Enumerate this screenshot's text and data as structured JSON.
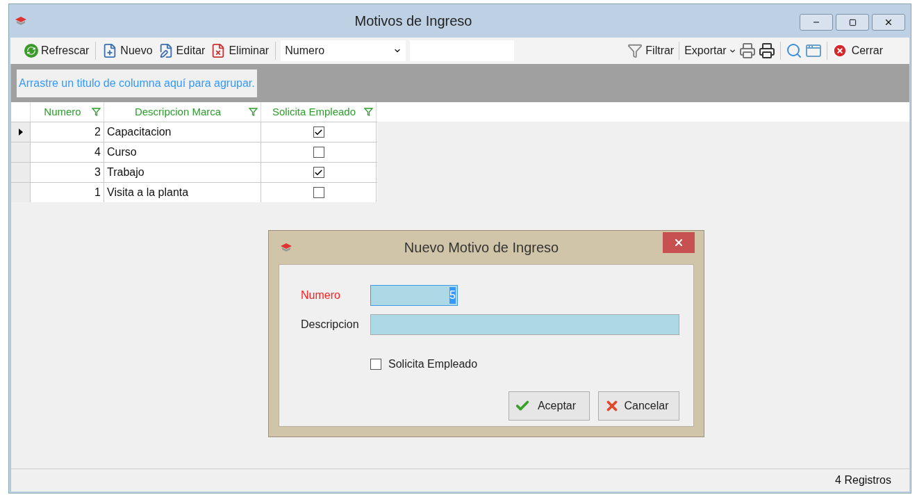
{
  "window": {
    "title": "Motivos de Ingreso"
  },
  "toolbar": {
    "buttons": [
      {
        "kind": "refresh",
        "label": "Refrescar"
      },
      {
        "kind": "new",
        "label": "Nuevo"
      },
      {
        "kind": "edit",
        "label": "Editar"
      },
      {
        "kind": "delete",
        "label": "Eliminar"
      }
    ],
    "column_select": {
      "value": "Numero"
    },
    "filter_button": "Filtrar",
    "export_button": "Exportar",
    "close_button": "Cerrar"
  },
  "group_panel": {
    "hint": "Arrastre un titulo de columna aquí para agrupar."
  },
  "grid": {
    "columns": [
      "Numero",
      "Descripcion Marca",
      "Solicita Empleado"
    ],
    "rows": [
      {
        "numero": "2",
        "descripcion": "Capacitacion",
        "solicita_empleado": true,
        "selected": true
      },
      {
        "numero": "4",
        "descripcion": "Curso",
        "solicita_empleado": false,
        "selected": false
      },
      {
        "numero": "3",
        "descripcion": "Trabajo",
        "solicita_empleado": true,
        "selected": false
      },
      {
        "numero": "1",
        "descripcion": "Visita a la planta",
        "solicita_empleado": false,
        "selected": false
      }
    ]
  },
  "status_bar": {
    "count": "4 Registros"
  },
  "dialog": {
    "title": "Nuevo Motivo de Ingreso",
    "fields": [
      {
        "label": "Numero",
        "value": "5",
        "required": true,
        "focused": true
      },
      {
        "label": "Descripcion",
        "required": false,
        "focused": false
      }
    ],
    "checkbox": {
      "label": "Solicita Empleado",
      "checked": false
    },
    "buttons": [
      {
        "kind": "accept",
        "label": "Aceptar"
      },
      {
        "kind": "cancel",
        "label": "Cancelar"
      }
    ]
  }
}
